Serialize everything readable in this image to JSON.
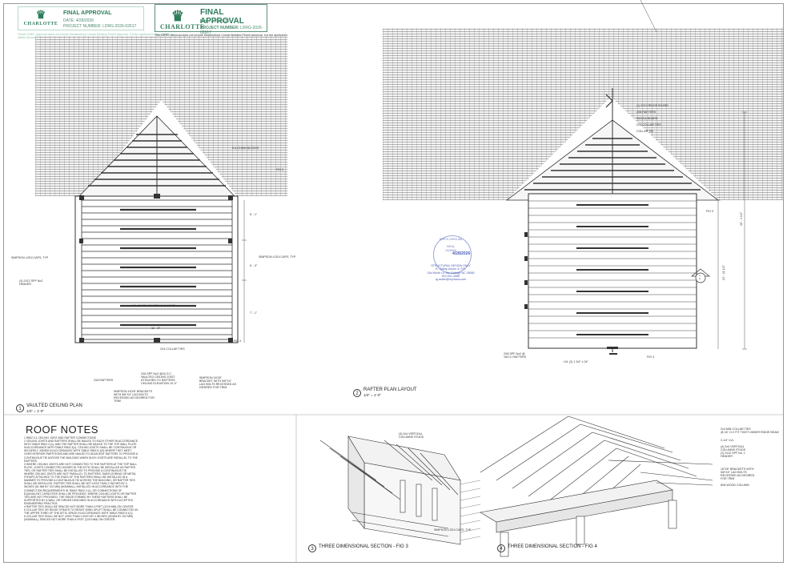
{
  "stamp_small": {
    "city": "CHARLOTTE",
    "title": "FINAL APPROVAL",
    "date_line": "DATE: 4/28/2026",
    "project_line": "PROJECT NUMBER: LDRG-2026-02617",
    "disclaimer": "These LDRG, approval does not include Mecklenburg County Building Permit approval. It is the applicant's responsibility to obtain all necessary permits prior to commencing construction."
  },
  "stamp_large": {
    "city": "CHARLOTTE",
    "title": "FINAL APPROVAL",
    "date_label": "Date:",
    "date_value": "4/28/2026",
    "project_label": "PROJECT NUMBER:",
    "project_value": "LDRG-2026-02617",
    "disclaimer": "This LDRG, approval does not include Mecklenburg County Building Permit approval. It is the applicant's responsibility to obtain all necessary permits prior to commencing construction."
  },
  "plan1": {
    "num": "1",
    "title": "VAULTED CEILING PLAN",
    "scale": "1/4\" = 1'-0\"",
    "labels": {
      "chain_blocks": "6 A-CHAIN BLOCKS",
      "fig3": "FIG 3",
      "simpson_left": "SIMPSON LCE4 CAPS, TYP",
      "simpson_right": "SIMPSON LCE4 CAPS, TYP",
      "header": "(3) 2X12 SPF No2\nHEADER",
      "joist_span": "18' - 7 1/2\" VAULTED CLG JOIST",
      "dim_small": "11' - 8\"",
      "fig4": "FIG 4",
      "collar_ties": "2X4 COLLAR TIES",
      "rafters": "2X8 RAFTERS",
      "vaulted_joist": "2X8 SPF No2 @16 O.C.\nVAULTED CEILING JOIST\nATTACHED TO RAFTERS\nCEILING ELEVATION 10'-0\"",
      "bracket_right": "SIMPSON 16'X8\"\nBRACKET WITH 5/8\"X4\"\nLAG BOLTS RECESSED AS\nDESIRED FOR TRIM",
      "bracket_bottom": "SIMPSON 16'X8\" BRACKETS\nWITH 5/8\"X4\" LAG BOLTS\nRECESSED AS DESIRED FOR\nTRIM",
      "dim1": "6' - 1\"",
      "dim2": "6' - 0\"",
      "dim3": "7' - 1\""
    }
  },
  "plan2": {
    "num": "2",
    "title": "RAFTER PLAN LAYOUT",
    "scale": "1/4\" = 1'-0\"",
    "labels": {
      "ridge": "(1) 2X10 RIDGE BOARD\n2X8 RAFTERS\nFASCIA BOARD\n2X4 COLLAR TIES\nCOLLAR TIE",
      "fig3": "FIG 3",
      "fig4": "FIG 4",
      "rafters": "2X8 SPF No2 @\n16O.C RAFTERS",
      "lvl": "LVL (2) 1 3/4\" x 24\"",
      "dim_total": "20' - 4 1/2\"",
      "dim_main": "24' - 11 1/2\"",
      "section": "1\nA"
    }
  },
  "seal": {
    "ring_text": "NORTH CAROLINA",
    "seal_label": "SEAL",
    "seal_number": "044993",
    "date": "4/28/2026",
    "line1": "STRUCTURAL DESIGN ONLY",
    "line2": "R. Gallay Austin Jr. P.E.",
    "line3": "13a Worth Ln. Sm Raleigh NC 28080",
    "line4": "910-001-2688",
    "line5": "rg.austin@myihaus.com"
  },
  "roof_notes": {
    "title": "ROOF NOTES",
    "body": "1 R802.3.1 CEILING JOIST AND RAFTER CONNECTIONS\n2 CEILING JOISTS AND RAFTERS SHALL BE NAILED TO EACH OTHER IN ACCORDANCE WITH TABLE R602.3 (1), AND THE RAFTER SHALL BE NAILED TO THE TOP WALL PLATE IN ACCORDANCE WITH TABLE R602.3(1). CEILING JOISTS SHALL BE CONTINUOUS OR SECURELY JOINED IN ACCORDANCE WITH TABLE R802.5.1(9) WHERE THEY MEET OVER INTERIOR PARTITIONS AND ARE NAILED TO ADJACENT RAFTERS TO PROVIDE A CONTINUOUS TIE ACROSS THE BUILDING WHEN SUCH JOISTS ARE PARALLEL TO THE RAFTERS.\n3 WHERE CEILING JOISTS ARE NOT CONNECTED TO THE RAFTERS AT THE TOP WALL PLATE, JOISTS CONNECTED HIGHER IN THE ATTIC SHALL BE INSTALLED AS RAFTER TIES, OR RAFTER TIES SHALL BE INSTALLED TO PROVIDE A CONTINUOUS TIE. WHERE CEILING JOISTS ARE NOT PARALLEL TO RAFTERS, SUBFLOORING OR METAL STRAPS ATTACHED TO THE ENDS OF THE RAFTERS SHALL BE INSTALLED IN A MANNER TO PROVIDE A CONTINUOUS TIE ACROSS THE BUILDING, OR RAFTER TIES SHALL BE INSTALLED. RAFTER TIES SHALL BE NOT LESS THAN 2 INCHES BY 4 INCHES (51 MM BY 102 MM) (NOMINAL), INSTALLED IN ACCORDANCE WITH THE CONNECTION REQUIREMENTS IN TABLE R602.3 (1), OR CONNECTIONS OF EQUIVALENT CAPACITIES SHALL BE PROVIDED. WHERE CEILING JOISTS OR RAFTER TIES ARE NOT PROVIDED, THE RIDGE FORMED BY THESE RAFTERS SHALL BE SUPPORTED BY A WALL OR GIRDER DESIGNED IN ACCORDANCE WITH ACCEPTED ENGINEERING PRACTICE.\n4 RAFTER TIES SHALL BE SPACED NOT MORE THAN 4 FEET (1219 MM) ON CENTER.\n5 COLLAR TIES OR RIDGE STRAPS TO RESIST WIND UPLIFT SHALL BE CONNECTED IN THE UPPER THIRD OF THE ATTIC SPACE IN ACCORDANCE WITH TABLE R802.5.1(1).\n6 COLLAR TIES SHALL BE NOT LESS THAN 1 INCH BY 4 INCHES (25 MM BY 102 MM) (NOMINAL), SPACED NOT MORE THAN 4 FEET (1219 MM) ON CENTER."
  },
  "fig3": {
    "num": "3",
    "title": "THREE DIMENSIONAL SECTION - FIG 3",
    "label_studs": "(3) 2x4 VERTICAL\nCOLUMNS STUDS",
    "label_caps": "SIMPSON LCE4 CAPS, TYP"
  },
  "fig4": {
    "num": "4",
    "title": "THREE DIMENSIONAL SECTION - FIG 4",
    "label1": "2x4 MIN COLLAR TIES\n@ 16\" O.C FIT TIGHT UNDER RIDGE BEAM",
    "label2": "2-1/4\" LVL",
    "label3": "(4) 2x4 VERTICAL\nCOLUMNS STUDS\n(2) 2x12 SPF No. 1\nHEADER",
    "label4": "16\"X8\" BRACKETS WITH\n5/8\"X4\" LAG BOLTS\nRECESSED AS DESIRED\nFOR TRIM",
    "label5": "8X8 WOOD COLUMN"
  }
}
